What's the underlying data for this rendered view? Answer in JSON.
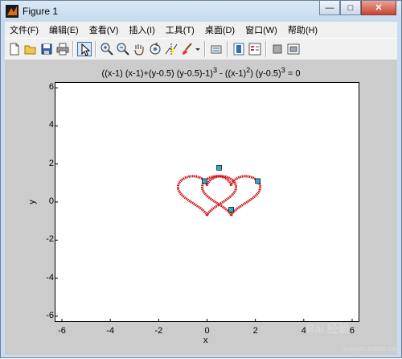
{
  "window": {
    "title": "Figure 1",
    "colors": {
      "frame": "#c9dbee",
      "close": "#c9452f"
    }
  },
  "window_buttons": {
    "minimize": "—",
    "maximize": "□",
    "close": "✕"
  },
  "menu": [
    {
      "label": "文件(F)"
    },
    {
      "label": "编辑(E)"
    },
    {
      "label": "查看(V)"
    },
    {
      "label": "插入(I)"
    },
    {
      "label": "工具(T)"
    },
    {
      "label": "桌面(D)"
    },
    {
      "label": "窗口(W)"
    },
    {
      "label": "帮助(H)"
    }
  ],
  "toolbar": {
    "icons": [
      "new-file-icon",
      "open-folder-icon",
      "save-icon",
      "print-icon",
      "pointer-icon",
      "zoom-in-icon",
      "zoom-out-icon",
      "pan-hand-icon",
      "rotate-3d-icon",
      "data-cursor-icon",
      "brush-icon",
      "dropdown-arrow-icon",
      "link-icon",
      "colorbar-icon",
      "legend-icon",
      "hide-plot-tools-icon",
      "show-plot-tools-icon"
    ]
  },
  "plot": {
    "title_main": "((x-1) (x-1)+(y-0.5) (y-0.5)-1)",
    "title_exp1": "3",
    "title_mid": " - ((x-1)",
    "title_exp2": "2",
    "title_mid2": ") (y-0.5)",
    "title_exp3": "3",
    "title_end": " = 0",
    "xlabel": "x",
    "ylabel": "y"
  },
  "chart_data": {
    "type": "line",
    "title": "((x-1) (x-1)+(y-0.5) (y-0.5)-1)^3 - ((x-1)^2) (y-0.5)^3 = 0",
    "xlabel": "x",
    "ylabel": "y",
    "xlim": [
      -6.3,
      6.3
    ],
    "ylim": [
      -6.3,
      6.3
    ],
    "xticks": [
      -6,
      -4,
      -2,
      0,
      2,
      4,
      6
    ],
    "yticks": [
      -6,
      -4,
      -2,
      0,
      2,
      4,
      6
    ],
    "xtick_labels": [
      "-6",
      "-4",
      "-2",
      "0",
      "2",
      "4",
      "6"
    ],
    "ytick_labels": [
      "6",
      "4",
      "2",
      "0",
      "-2",
      "-4",
      "-6"
    ],
    "series": [
      {
        "color": "#cc1111",
        "description_points": "heart centered at (0,0.5)",
        "cx": 0,
        "cy": 0.5
      },
      {
        "color": "#cc1111",
        "description_points": "heart centered at (1,0.5)",
        "cx": 1,
        "cy": 0.5
      }
    ],
    "markers": [
      {
        "x": -0.1,
        "y": 1.1
      },
      {
        "x": 0.5,
        "y": 1.8
      },
      {
        "x": 2.1,
        "y": 1.1
      },
      {
        "x": 1.0,
        "y": -0.4
      }
    ],
    "marker_color": "#33aacc"
  },
  "watermark": {
    "text": "Bai 经验",
    "sub": "jingyan.baidu.com"
  }
}
